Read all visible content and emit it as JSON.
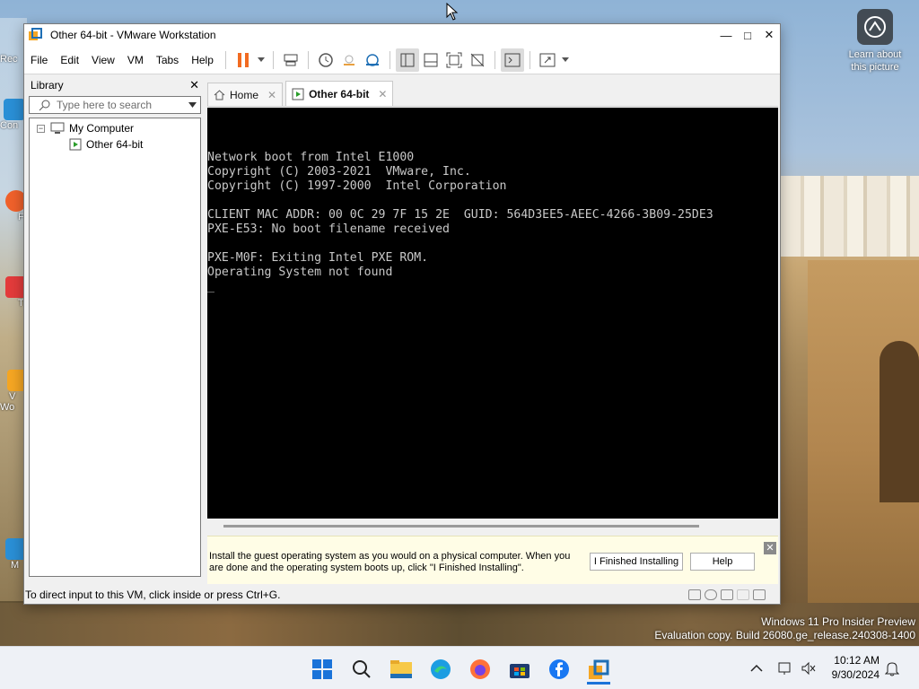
{
  "desktop": {
    "learn_label": "Learn about this picture",
    "evaluation_line1": "Windows 11 Pro Insider Preview",
    "evaluation_line2": "Evaluation copy. Build 26080.ge_release.240308-1400",
    "icon_labels": [
      "Rec",
      "Con",
      "F",
      "T",
      "V Wo",
      "M"
    ]
  },
  "window": {
    "title": "Other 64-bit - VMware Workstation",
    "menu": [
      "File",
      "Edit",
      "View",
      "VM",
      "Tabs",
      "Help"
    ],
    "colors": {
      "pause_orange": "#f26b21",
      "vmware_blue": "#1f6fb5"
    }
  },
  "library": {
    "title": "Library",
    "search_placeholder": "Type here to search",
    "tree": [
      {
        "label": "My Computer",
        "expanded": true
      },
      {
        "label": "Other 64-bit",
        "selected": true
      }
    ]
  },
  "tabs": [
    {
      "label": "Home",
      "icon": "home-icon"
    },
    {
      "label": "Other 64-bit",
      "icon": "vm-icon",
      "active": true
    }
  ],
  "console": {
    "lines": [
      "",
      "",
      "",
      "Network boot from Intel E1000",
      "Copyright (C) 2003-2021  VMware, Inc.",
      "Copyright (C) 1997-2000  Intel Corporation",
      "",
      "CLIENT MAC ADDR: 00 0C 29 7F 15 2E  GUID: 564D3EE5-AEEC-4266-3B09-25DE3",
      "PXE-E53: No boot filename received",
      "",
      "PXE-M0F: Exiting Intel PXE ROM.",
      "Operating System not found",
      "_"
    ]
  },
  "install_bar": {
    "message": "Install the guest operating system as you would on a physical computer. When you are done and the operating system boots up, click \"I Finished Installing\".",
    "finished_button": "I Finished Installing",
    "help_button": "Help"
  },
  "statusbar": {
    "text": "To direct input to this VM, click inside or press Ctrl+G."
  },
  "taskbar": {
    "time": "10:12 AM",
    "date": "9/30/2024"
  }
}
